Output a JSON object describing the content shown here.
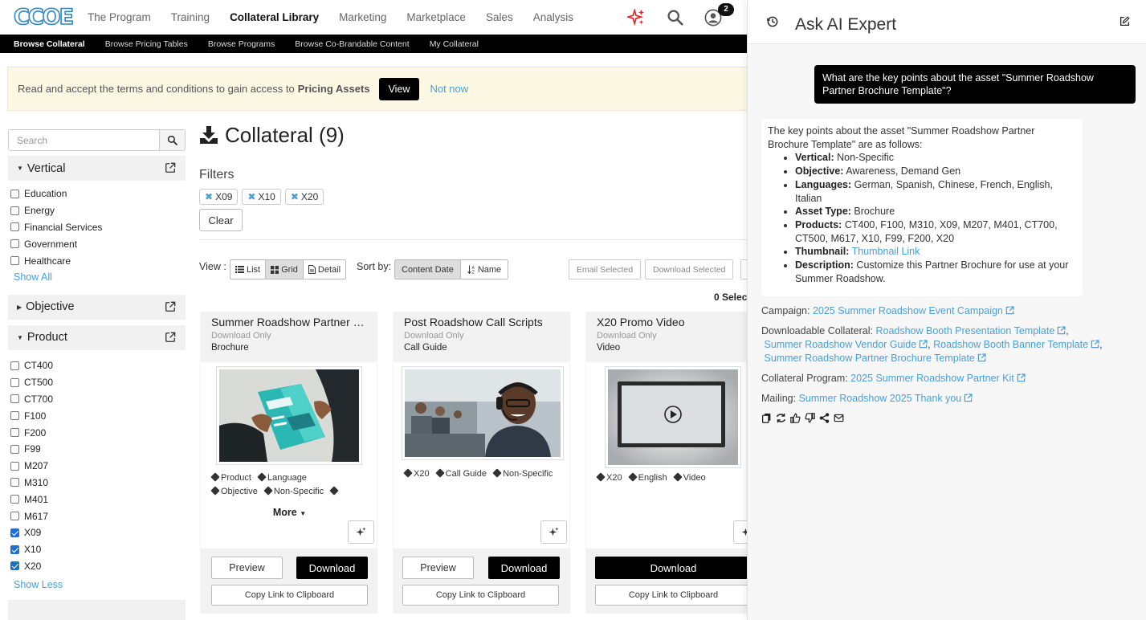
{
  "nav": {
    "logo_text": "CCOE",
    "items": [
      {
        "label": "The Program",
        "active": false
      },
      {
        "label": "Training",
        "active": false
      },
      {
        "label": "Collateral Library",
        "active": true
      },
      {
        "label": "Marketing",
        "active": false
      },
      {
        "label": "Marketplace",
        "active": false
      },
      {
        "label": "Sales",
        "active": false
      },
      {
        "label": "Analysis",
        "active": false
      }
    ],
    "notification_count": "2",
    "icons": [
      "sparkle-icon",
      "search-icon",
      "user-icon"
    ]
  },
  "subnav": {
    "items": [
      {
        "label": "Browse Collateral",
        "active": true
      },
      {
        "label": "Browse Pricing Tables",
        "active": false
      },
      {
        "label": "Browse Programs",
        "active": false
      },
      {
        "label": "Browse Co-Brandable Content",
        "active": false
      },
      {
        "label": "My Collateral",
        "active": false
      }
    ]
  },
  "banner": {
    "text": "Read and accept the terms and conditions to gain access to",
    "bold": "Pricing Assets",
    "view_label": "View",
    "not_now_label": "Not now"
  },
  "sidebar": {
    "search_placeholder": "Search",
    "vertical": {
      "title": "Vertical",
      "items": [
        {
          "label": "Education",
          "checked": false
        },
        {
          "label": "Energy",
          "checked": false
        },
        {
          "label": "Financial Services",
          "checked": false
        },
        {
          "label": "Government",
          "checked": false
        },
        {
          "label": "Healthcare",
          "checked": false
        }
      ],
      "toggle_label": "Show All"
    },
    "objective": {
      "title": "Objective"
    },
    "product": {
      "title": "Product",
      "items": [
        {
          "label": "CT400",
          "checked": false
        },
        {
          "label": "CT500",
          "checked": false
        },
        {
          "label": "CT700",
          "checked": false
        },
        {
          "label": "F100",
          "checked": false
        },
        {
          "label": "F200",
          "checked": false
        },
        {
          "label": "F99",
          "checked": false
        },
        {
          "label": "M207",
          "checked": false
        },
        {
          "label": "M310",
          "checked": false
        },
        {
          "label": "M401",
          "checked": false
        },
        {
          "label": "M617",
          "checked": false
        },
        {
          "label": "X09",
          "checked": true
        },
        {
          "label": "X10",
          "checked": true
        },
        {
          "label": "X20",
          "checked": true
        }
      ],
      "toggle_label": "Show Less"
    }
  },
  "main": {
    "title": "Collateral (9)",
    "filters_label": "Filters",
    "chips": [
      "X09",
      "X10",
      "X20"
    ],
    "clear_label": "Clear",
    "view_label": "View :",
    "view_options": [
      {
        "label": "List",
        "active": false
      },
      {
        "label": "Grid",
        "active": true
      },
      {
        "label": "Detail",
        "active": false
      }
    ],
    "sort_label": "Sort by:",
    "sort_options": [
      {
        "label": "Content Date",
        "active": true
      },
      {
        "label": "Name",
        "active": false
      }
    ],
    "email_selected_label": "Email Selected",
    "download_selected_label": "Download Selected",
    "selected_count": "0 Selec",
    "cards": [
      {
        "title": "Summer Roadshow Partner Brochure Template",
        "sub": "Download Only",
        "type": "Brochure",
        "tags": [
          "Product",
          "Language",
          "Objective",
          "Non-Specific",
          ""
        ],
        "more_label": "More",
        "preview_label": "Preview",
        "download_label": "Download",
        "copy_label": "Copy Link to Clipboard"
      },
      {
        "title": "Post Roadshow Call Scripts",
        "sub": "Download Only",
        "type": "Call Guide",
        "tags": [
          "X20",
          "Call Guide",
          "Non-Specific"
        ],
        "preview_label": "Preview",
        "download_label": "Download",
        "copy_label": "Copy Link to Clipboard"
      },
      {
        "title": "X20 Promo Video",
        "sub": "Download Only",
        "type": "Video",
        "tags": [
          "X20",
          "English",
          "Video"
        ],
        "download_label": "Download",
        "copy_label": "Copy Link to Clipboard"
      }
    ]
  },
  "ai": {
    "title": "Ask AI Expert",
    "question": "What are the key points about the asset \"Summer Roadshow Partner Brochure Template\"?",
    "answer_intro": "The key points about the asset \"Summer Roadshow Partner Brochure Template\" are as follows:",
    "points": [
      {
        "k": "Vertical:",
        "v": "Non-Specific"
      },
      {
        "k": "Objective:",
        "v": "Awareness, Demand Gen"
      },
      {
        "k": "Languages:",
        "v": "German, Spanish, Chinese, French, English, Italian"
      },
      {
        "k": "Asset Type:",
        "v": "Brochure"
      },
      {
        "k": "Products:",
        "v": "CT400, F100, M310, X09, M207, M401, CT700, CT500, M617, X10, F99, F200, X20"
      },
      {
        "k": "Thumbnail:",
        "v": "Thumbnail Link"
      },
      {
        "k": "Description:",
        "v": "Customize this Partner Brochure for use at your Summer Roadshow."
      }
    ],
    "campaign_label": "Campaign:",
    "campaign_link": "2025 Summer Roadshow Event Campaign",
    "downloadable_label": "Downloadable Collateral:",
    "downloadable_links": [
      "Roadshow Booth Presentation Template",
      "Summer Roadshow Vendor Guide",
      "Roadshow Booth Banner Template",
      "Summer Roadshow Partner Brochure Template"
    ],
    "program_label": "Collateral Program:",
    "program_link": "2025 Summer Roadshow Partner Kit",
    "mailing_label": "Mailing:",
    "mailing_link": "Summer Roadshow 2025 Thank you",
    "tool_icons": [
      "copy-icon",
      "retry-icon",
      "thumbs-up-icon",
      "thumbs-down-icon",
      "share-icon",
      "email-icon"
    ]
  }
}
